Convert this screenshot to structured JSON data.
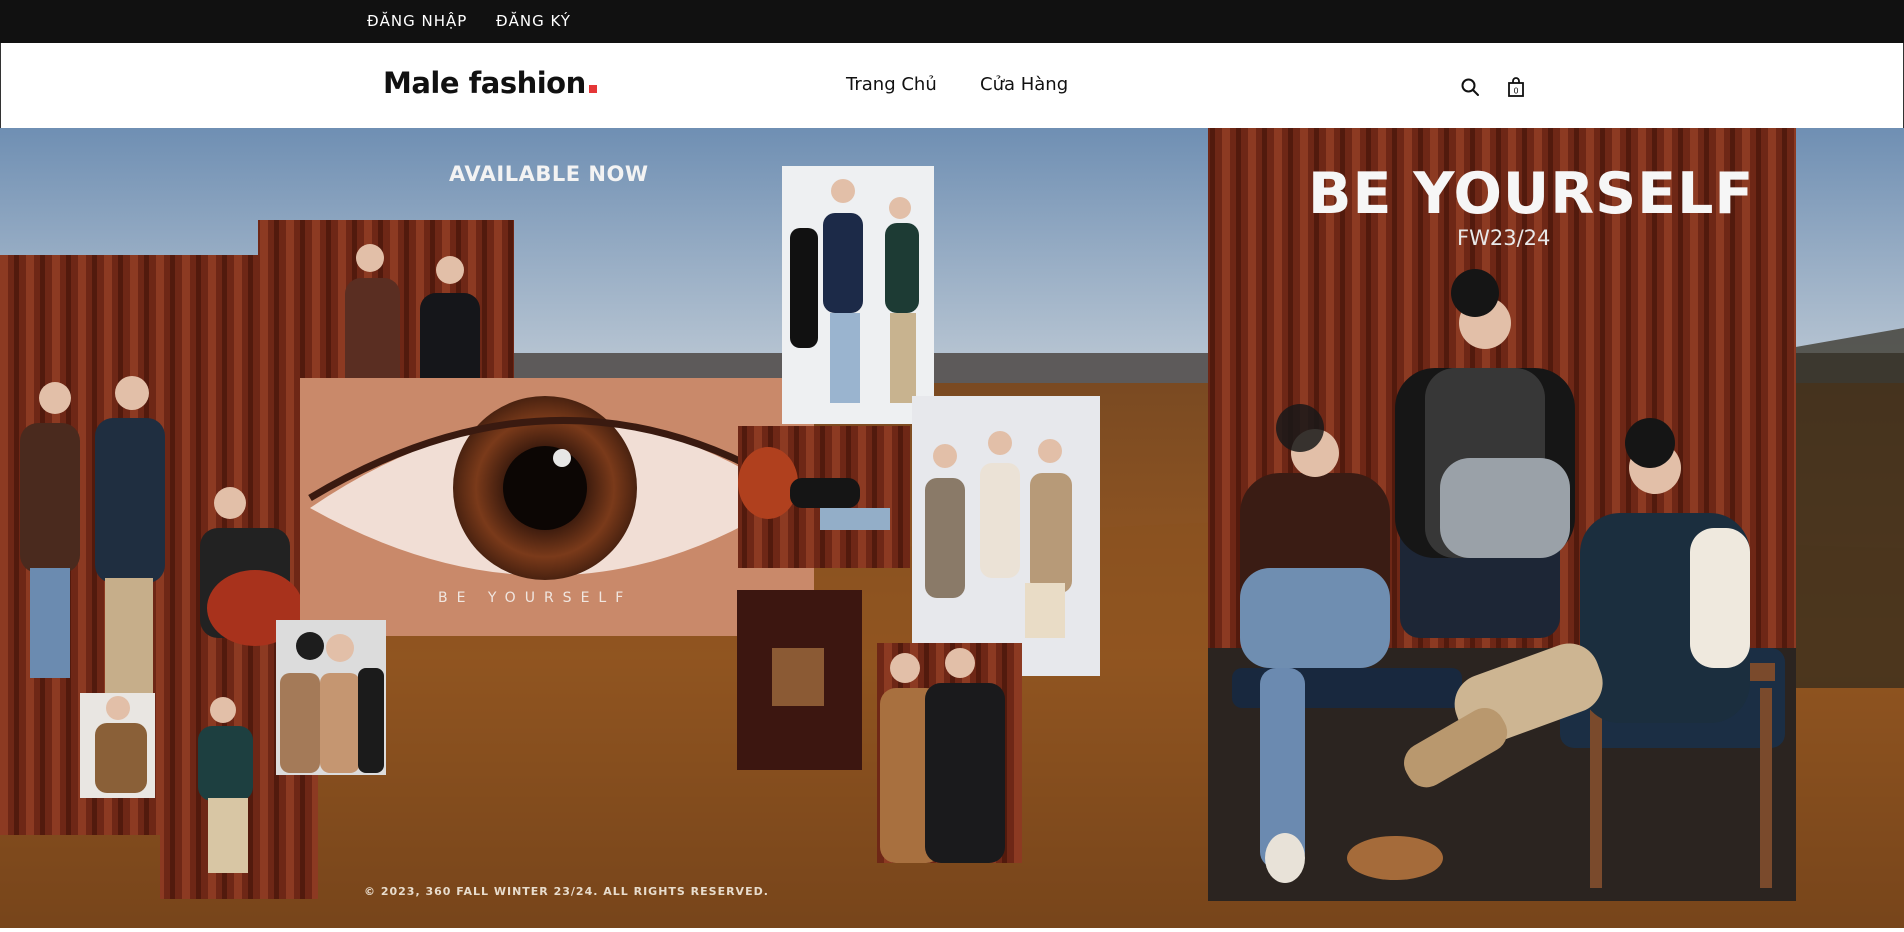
{
  "topbar": {
    "login_label": "ĐĂNG NHẬP",
    "register_label": "ĐĂNG KÝ"
  },
  "header": {
    "logo_text": "Male fashion",
    "logo_dot_color": "#e53637",
    "nav": {
      "home_label": "Trang Chủ",
      "shop_label": "Cửa Hàng"
    },
    "icons": {
      "search": "search-icon",
      "bag": "shopping-bag-icon",
      "bag_count": "0"
    }
  },
  "hero": {
    "available_text": "AVAILABLE NOW",
    "headline": "BE YOURSELF",
    "season": "FW23/24",
    "eye_caption": "BE YOURSELF",
    "copyright": "© 2023, 360 FALL WINTER 23/24. ALL RIGHTS RESERVED."
  }
}
